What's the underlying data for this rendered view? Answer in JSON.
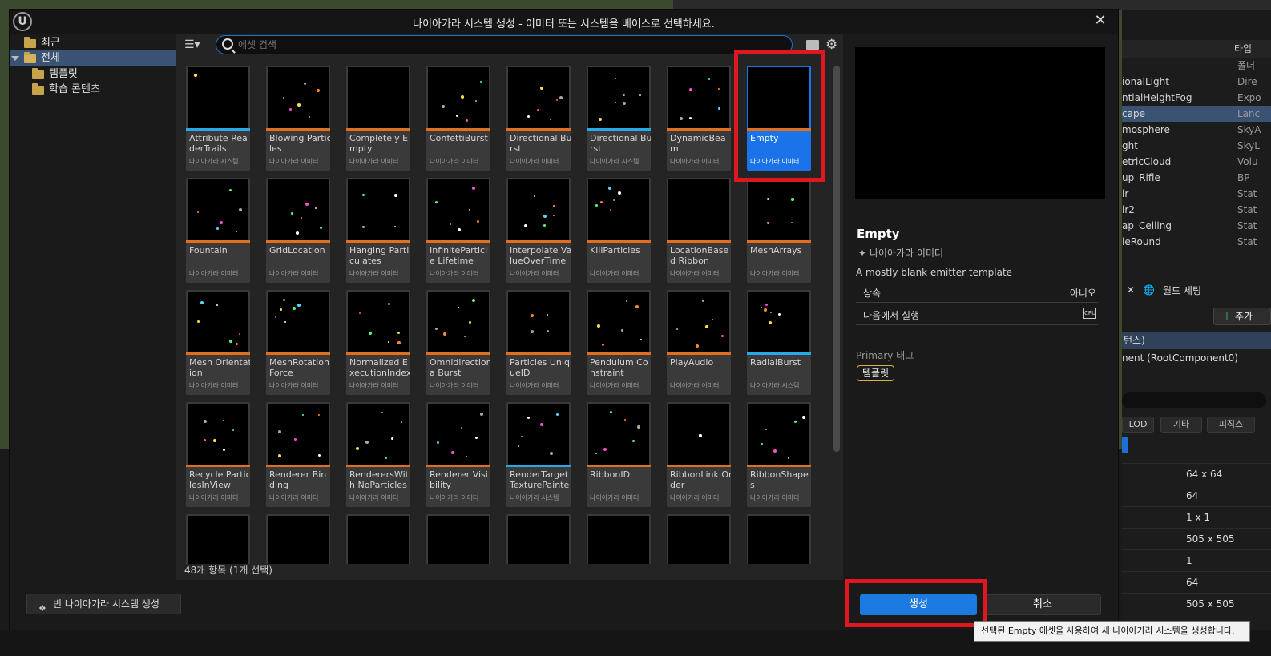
{
  "dialog": {
    "title": "나이아가라 시스템 생성 - 이미터 또는 시스템을 베이스로 선택하세요.",
    "close_label": "✕"
  },
  "tree": {
    "items": [
      {
        "label": "최근"
      },
      {
        "label": "전체"
      },
      {
        "label": "템플릿"
      },
      {
        "label": "학습 콘텐츠"
      }
    ]
  },
  "search": {
    "placeholder": "에셋 검색",
    "value": ""
  },
  "assets": [
    {
      "name": "Attribute ReaderTrails",
      "type": "나이아가라 시스템"
    },
    {
      "name": "Blowing Particles",
      "type": "나이아가라 이미터"
    },
    {
      "name": "Completely Empty",
      "type": "나이아가라 이미터"
    },
    {
      "name": "ConfettiBurst",
      "type": "나이아가라 이미터"
    },
    {
      "name": "Directional Burst",
      "type": "나이아가라 이미터"
    },
    {
      "name": "Directional Burst",
      "type": "나이아가라 시스템"
    },
    {
      "name": "DynamicBeam",
      "type": "나이아가라 이미터"
    },
    {
      "name": "Empty",
      "type": "나이아가라 이미터"
    },
    {
      "name": "Fountain",
      "type": "나이아가라 이미터"
    },
    {
      "name": "GridLocation",
      "type": "나이아가라 이미터"
    },
    {
      "name": "Hanging Particulates",
      "type": "나이아가라 이미터"
    },
    {
      "name": "InfiniteParticle Lifetime",
      "type": "나이아가라 이미터"
    },
    {
      "name": "Interpolate ValueOverTime",
      "type": "나이아가라 이미터"
    },
    {
      "name": "KillParticles",
      "type": "나이아가라 이미터"
    },
    {
      "name": "LocationBased Ribbon",
      "type": "나이아가라 이미터"
    },
    {
      "name": "MeshArrays",
      "type": "나이아가라 이미터"
    },
    {
      "name": "Mesh Orientation",
      "type": "나이아가라 이미터"
    },
    {
      "name": "MeshRotation Force",
      "type": "나이아가라 이미터"
    },
    {
      "name": "Normalized ExecutionIndex",
      "type": "나이아가라 이미터"
    },
    {
      "name": "Omnidirectiona Burst",
      "type": "나이아가라 이미터"
    },
    {
      "name": "Particles UniqueID",
      "type": "나이아가라 이미터"
    },
    {
      "name": "Pendulum Constraint",
      "type": "나이아가라 이미터"
    },
    {
      "name": "PlayAudio",
      "type": "나이아가라 이미터"
    },
    {
      "name": "RadialBurst",
      "type": "나이아가라 시스템"
    },
    {
      "name": "Recycle ParticlesInView",
      "type": "나이아가라 이미터"
    },
    {
      "name": "Renderer Binding",
      "type": "나이아가라 이미터"
    },
    {
      "name": "RenderersWith NoParticles",
      "type": "나이아가라 이미터"
    },
    {
      "name": "Renderer Visibility",
      "type": "나이아가라 이미터"
    },
    {
      "name": "RenderTarget TexturePainter",
      "type": "나이아가라 시스템"
    },
    {
      "name": "RibbonID",
      "type": "나이아가라 이미터"
    },
    {
      "name": "RibbonLink Order",
      "type": "나이아가라 이미터"
    },
    {
      "name": "RibbonShapes",
      "type": "나이아가라 이미터"
    }
  ],
  "status": {
    "count_text": "48개 항목 (1개 선택)"
  },
  "details": {
    "name": "Empty",
    "type": "나이아가라 이미터",
    "description": "A mostly blank emitter template",
    "inherit_label": "상속",
    "inherit_value": "아니오",
    "run_on_label": "다음에서 실행",
    "run_on_icon": "CPU",
    "primary_tags_label": "Primary 태그",
    "tag": "템플릿"
  },
  "footer": {
    "empty_button": "빈 나이아가라 시스템 생성",
    "create_button": "생성",
    "cancel_button": "취소"
  },
  "tooltip": "선택된 Empty 에셋을 사용하여 새 나이아가라 시스템을 생성합니다.",
  "background": {
    "outliner_header": "타입",
    "outliner_rows": [
      {
        "name": "",
        "type": "폴더"
      },
      {
        "name": "ionalLight",
        "type": "Dire"
      },
      {
        "name": "ntialHeightFog",
        "type": "Expo"
      },
      {
        "name": "cape",
        "type": "Lanc"
      },
      {
        "name": "mosphere",
        "type": "SkyA"
      },
      {
        "name": "ght",
        "type": "SkyL"
      },
      {
        "name": "etricCloud",
        "type": "Volu"
      },
      {
        "name": "up_Rifle",
        "type": "BP_"
      },
      {
        "name": "ir",
        "type": "Stat"
      },
      {
        "name": "ir2",
        "type": "Stat"
      },
      {
        "name": "ap_Ceiling",
        "type": "Stat"
      },
      {
        "name": "leRound",
        "type": "Stat"
      }
    ],
    "world_settings": "월드 세팅",
    "add_button": "추가",
    "component_bar": "턴스)",
    "component_row": "nent (RootComponent0)",
    "filters": [
      "LOD",
      "기타",
      "피직스"
    ],
    "props": [
      "64 x 64",
      "64",
      "1 x 1",
      "505 x 505",
      "1",
      "64",
      "505 x 505"
    ]
  }
}
